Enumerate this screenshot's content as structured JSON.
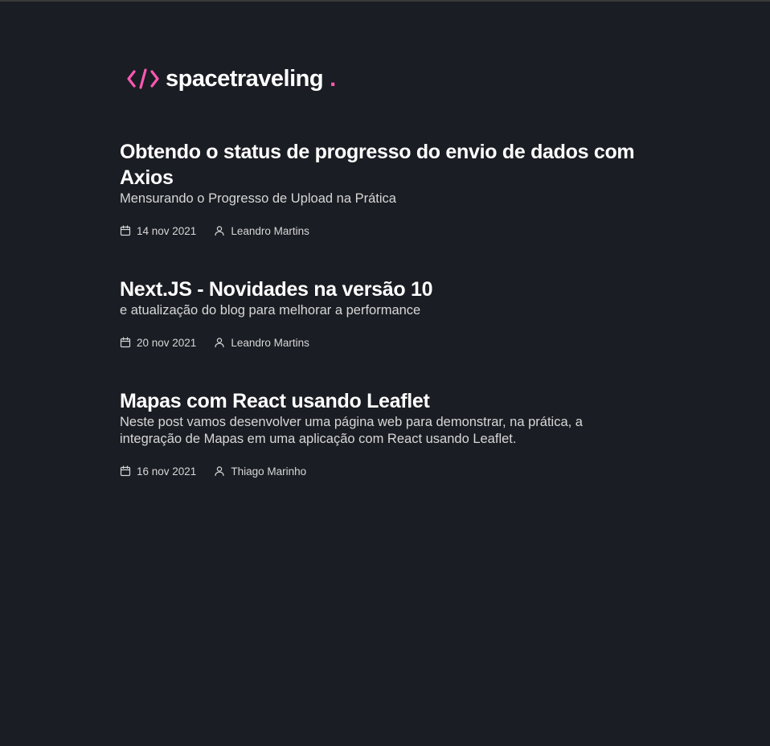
{
  "header": {
    "logo_icon": "code-brackets-icon",
    "logo_text": "spacetraveling",
    "logo_dot": "."
  },
  "colors": {
    "background": "#1a1d23",
    "accent": "#ff57b2",
    "title": "#ffffff",
    "text": "#d7d7d7"
  },
  "posts": [
    {
      "title": "Obtendo o status de progresso do envio de dados com Axios",
      "subtitle": "Mensurando o Progresso de Upload na Prática",
      "date": "14 nov 2021",
      "author": "Leandro Martins"
    },
    {
      "title": "Next.JS - Novidades na versão 10",
      "subtitle": "e atualização do blog para melhorar a performance",
      "date": "20 nov 2021",
      "author": "Leandro Martins"
    },
    {
      "title": "Mapas com React usando Leaflet",
      "subtitle": "Neste post vamos desenvolver uma página web para demonstrar, na prática, a integração de Mapas em uma aplicação com React usando Leaflet.",
      "date": "16 nov 2021",
      "author": "Thiago Marinho"
    }
  ]
}
